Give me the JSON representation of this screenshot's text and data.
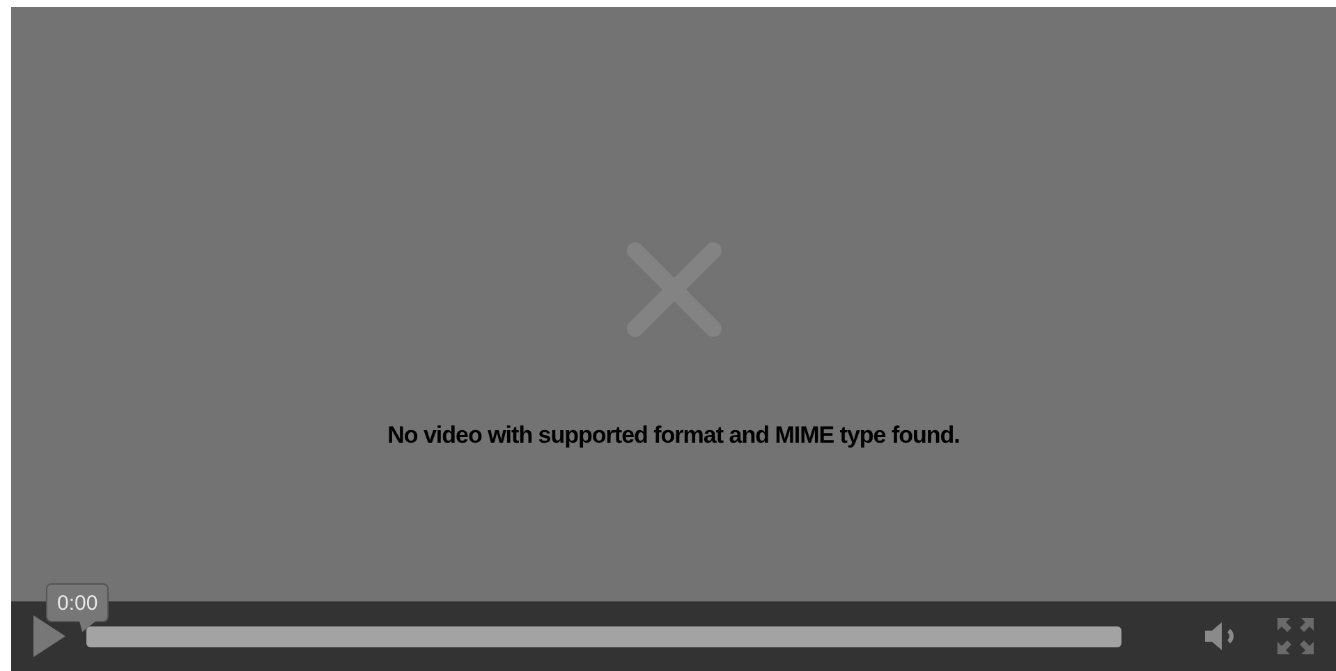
{
  "player": {
    "error_message": "No video with supported format and MIME type found.",
    "current_time": "0:00",
    "progress": {
      "level": 0
    }
  }
}
